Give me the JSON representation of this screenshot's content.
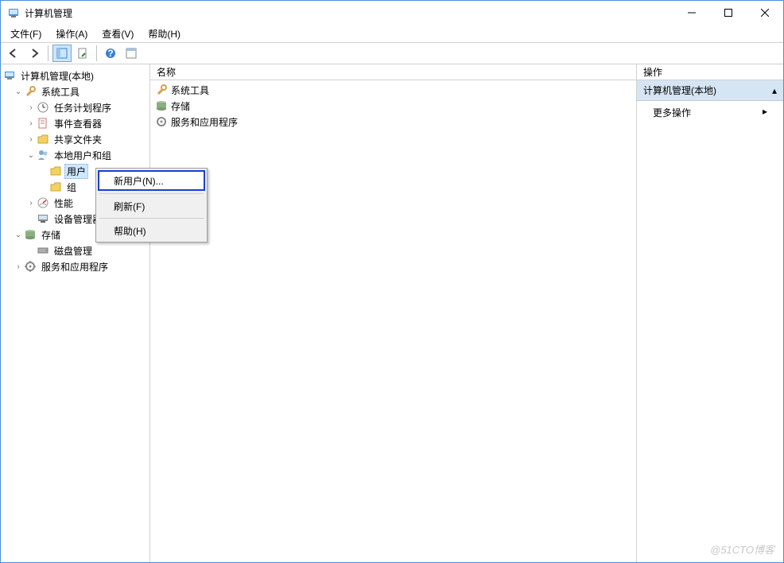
{
  "title": "计算机管理",
  "menubar": [
    "文件(F)",
    "操作(A)",
    "查看(V)",
    "帮助(H)"
  ],
  "tree": {
    "root": "计算机管理(本地)",
    "system_tools": "系统工具",
    "task_scheduler": "任务计划程序",
    "event_viewer": "事件查看器",
    "shared_folders": "共享文件夹",
    "local_users_groups": "本地用户和组",
    "users": "用户",
    "groups": "组",
    "performance": "性能",
    "device_manager": "设备管理器",
    "storage": "存储",
    "disk_management": "磁盘管理",
    "services_apps": "服务和应用程序"
  },
  "middle": {
    "header": "名称",
    "items": [
      "系统工具",
      "存储",
      "服务和应用程序"
    ]
  },
  "actions": {
    "header": "操作",
    "group": "计算机管理(本地)",
    "more": "更多操作"
  },
  "context_menu": {
    "new_user": "新用户(N)...",
    "refresh": "刷新(F)",
    "help": "帮助(H)"
  },
  "watermark": "@51CTO博客"
}
